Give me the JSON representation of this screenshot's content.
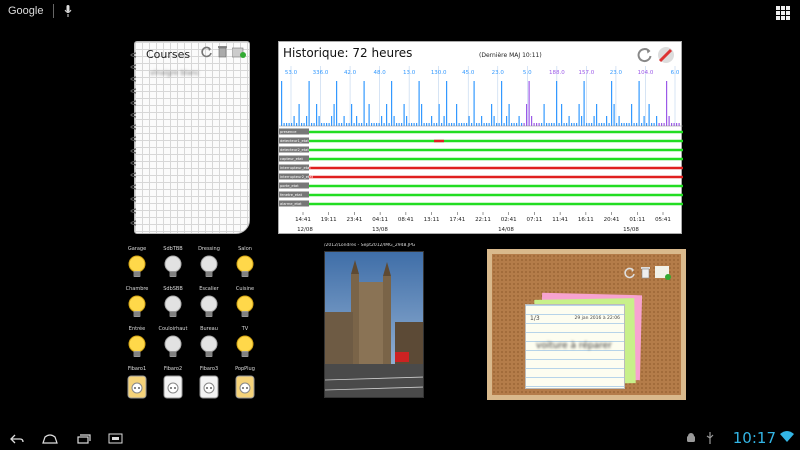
{
  "top": {
    "search_label": "Google"
  },
  "notebook": {
    "title": "Courses",
    "item": "vinaigre blanc"
  },
  "history": {
    "title": "Historique: 72 heures",
    "update": "(Dernière MAJ 10:11)",
    "tick_values": [
      "53.0",
      "336.0",
      "42.0",
      "48.0",
      "13.0",
      "130.0",
      "45.0",
      "23.0",
      "5.0",
      "188.0",
      "157.0",
      "23.0",
      "104.0",
      "6.0"
    ],
    "series_labels": [
      "presence",
      "detecteur1_etat",
      "detecteur2_etat",
      "capteur_etat",
      "interrupteur_etat",
      "interrupteur2_etat",
      "porte_etat",
      "fenetre_etat",
      "alarme_etat"
    ],
    "time_labels": [
      "14:41",
      "19:11",
      "23:41",
      "04:11",
      "08:41",
      "13:11",
      "17:41",
      "22:11",
      "02:41",
      "07:11",
      "11:41",
      "16:11",
      "20:41",
      "01:11",
      "05:41"
    ],
    "date_labels": [
      "12/08",
      "13/08",
      "14/08",
      "15/08"
    ]
  },
  "lights": [
    {
      "label": "Garage",
      "on": true
    },
    {
      "label": "SdbTBB",
      "on": false
    },
    {
      "label": "Dressing",
      "on": false
    },
    {
      "label": "Salon",
      "on": true
    },
    {
      "label": "Chambre",
      "on": true
    },
    {
      "label": "SdbSBB",
      "on": false
    },
    {
      "label": "Escalier",
      "on": false
    },
    {
      "label": "Cuisine",
      "on": true
    },
    {
      "label": "Entrée",
      "on": true
    },
    {
      "label": "Couloirhaut",
      "on": false
    },
    {
      "label": "Bureau",
      "on": false
    },
    {
      "label": "TV",
      "on": true
    },
    {
      "label": "Fibaro1",
      "on": true
    },
    {
      "label": "Fibaro2",
      "on": false
    },
    {
      "label": "Fibaro3",
      "on": false
    },
    {
      "label": "PopPlug",
      "on": true
    }
  ],
  "photo": {
    "caption": "/2012/Londres - Sept2012/IMG_2948.JPG"
  },
  "cork": {
    "count": "1/3",
    "date": "29 jan 2016 à 22:06",
    "text": "voiture à réparer"
  },
  "status": {
    "time": "10:17"
  },
  "colors": {
    "accent": "#33b5e5",
    "on_green": "#22dd22",
    "off_red": "#e02020",
    "bar_blue": "#3399ff",
    "bar_purple": "#9b59e8"
  }
}
